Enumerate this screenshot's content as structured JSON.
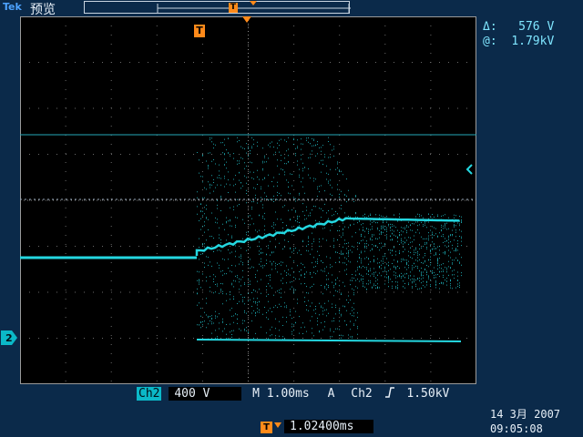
{
  "header": {
    "brand_logo": "Tek",
    "mode": "预览"
  },
  "cursor_readout": {
    "delta_label": "Δ:",
    "delta_value": "576 V",
    "at_label": "@:",
    "at_value": "1.79kV"
  },
  "markers": {
    "trigger_position": "T",
    "channel": "2"
  },
  "status_bar": {
    "channel": "Ch2",
    "volts_per_div": "400 V",
    "time_base": "M 1.00ms",
    "trigger_mode": "A",
    "trigger_source": "Ch2",
    "trigger_slope_icon": "rising-edge-icon",
    "trigger_level": "1.50kV"
  },
  "horizontal_delay": {
    "icon": "trigger-delay-icon",
    "icon_text": "T",
    "value": "1.02400ms"
  },
  "datetime": {
    "date": "14 3月  2007",
    "time": "09:05:08"
  },
  "colors": {
    "trace": "#24d7e0",
    "trigger": "#ff8a1a",
    "grid": "#6a6a6a",
    "panel": "#0b2a4a"
  }
}
